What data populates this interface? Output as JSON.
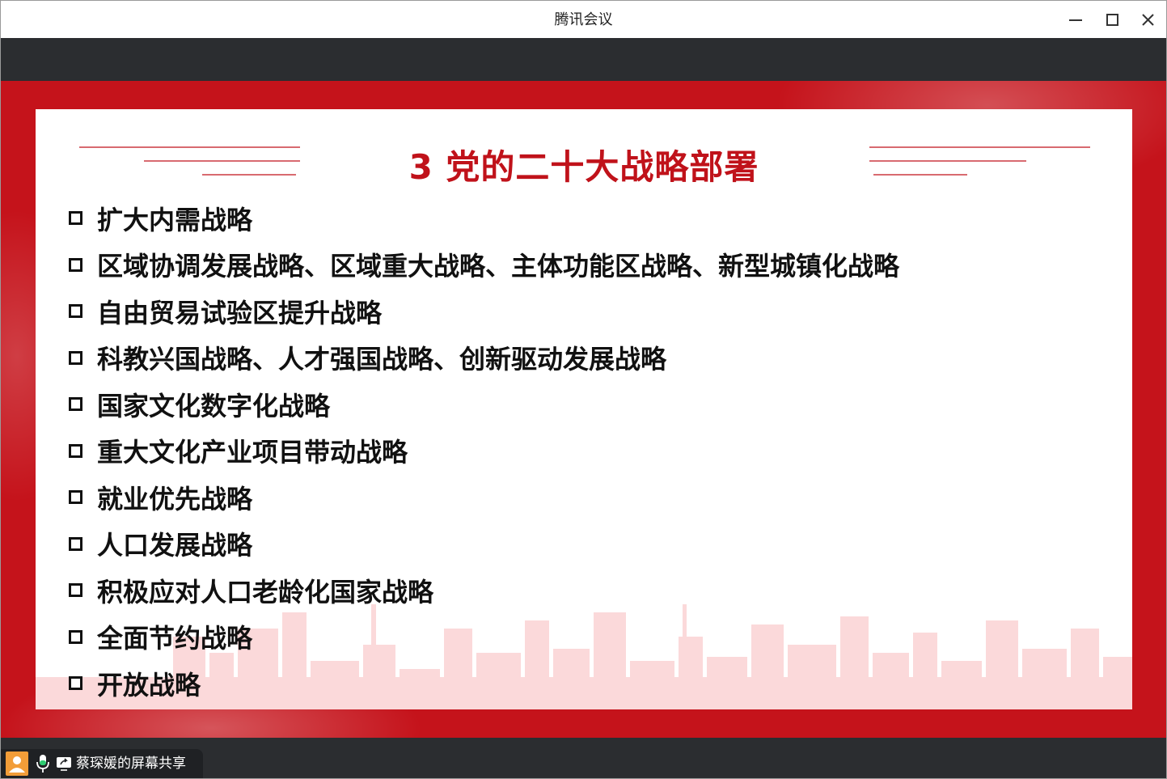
{
  "window": {
    "title": "腾讯会议",
    "controls": [
      "minimize-icon",
      "maximize-icon",
      "close-icon"
    ]
  },
  "slide": {
    "title": "3 党的二十大战略部署",
    "items": [
      "扩大内需战略",
      "区域协调发展战略、区域重大战略、主体功能区战略、新型城镇化战略",
      "自由贸易试验区提升战略",
      "科教兴国战略、人才强国战略、创新驱动发展战略",
      "国家文化数字化战略",
      "重大文化产业项目带动战略",
      "就业优先战略",
      "人口发展战略",
      "积极应对人口老龄化国家战略",
      "全面节约战略",
      "开放战略"
    ],
    "colors": {
      "frame": "#c5131b",
      "title": "#c0121a",
      "text": "#111111"
    }
  },
  "share_bar": {
    "label": "蔡琛媛的屏幕共享",
    "icons": [
      "user-avatar-icon",
      "microphone-icon",
      "screen-share-icon"
    ],
    "avatar_color": "#f29d38",
    "mic_color": "#2ecc71"
  }
}
